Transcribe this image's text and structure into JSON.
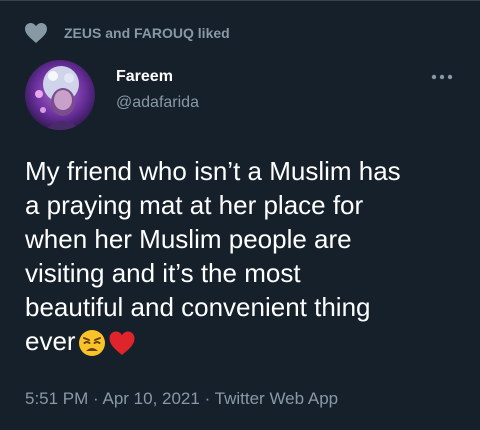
{
  "social_context": {
    "icon": "heart-icon",
    "text": "ZEUS and FAROUQ liked"
  },
  "author": {
    "name": "Fareem",
    "handle": "@adafarida"
  },
  "tweet": {
    "lines": [
      "My friend who isn’t a Muslim has",
      "a praying mat at her place for",
      "when her Muslim people are",
      "visiting and it’s the most",
      "beautiful and convenient thing",
      "ever"
    ],
    "emojis": [
      "weary-face-emoji",
      "red-heart-emoji"
    ]
  },
  "meta": {
    "time": "5:51 PM",
    "date": "Apr 10, 2021",
    "source": "Twitter Web App",
    "separator": " · "
  },
  "colors": {
    "background": "#15202b",
    "secondary_text": "#8899a6",
    "primary_text": "#ffffff"
  }
}
